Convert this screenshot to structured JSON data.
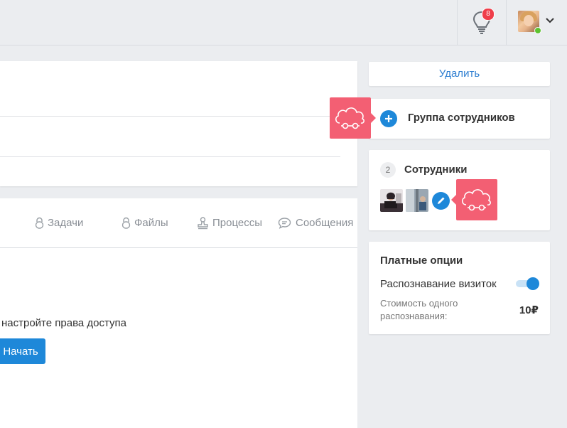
{
  "header": {
    "notifications_count": "8",
    "user_status_color": "#5cc230"
  },
  "main": {
    "tabs": [
      {
        "label": "Задачи",
        "icon": "lock-icon"
      },
      {
        "label": "Файлы",
        "icon": "lock-icon"
      },
      {
        "label": "Процессы",
        "icon": "stamp-icon"
      },
      {
        "label": "Сообщения",
        "icon": "chat-icon"
      }
    ],
    "access_text": "настройте права доступа",
    "start_button": "Начать"
  },
  "sidebar": {
    "delete_button": "Удалить",
    "group": {
      "title": "Группа сотрудников",
      "icon": "plus-icon"
    },
    "staff": {
      "count": "2",
      "title": "Сотрудники",
      "edit_icon": "pencil-icon"
    },
    "paid_options": {
      "title": "Платные опции",
      "recognition_label": "Распознавание визиток",
      "recognition_enabled": true,
      "cost_label": "Стоимость одного распознавания:",
      "cost_value": "10₽"
    }
  },
  "colors": {
    "accent": "#1e88d9",
    "badge": "#f35f73",
    "notification": "#ef3e4a"
  }
}
